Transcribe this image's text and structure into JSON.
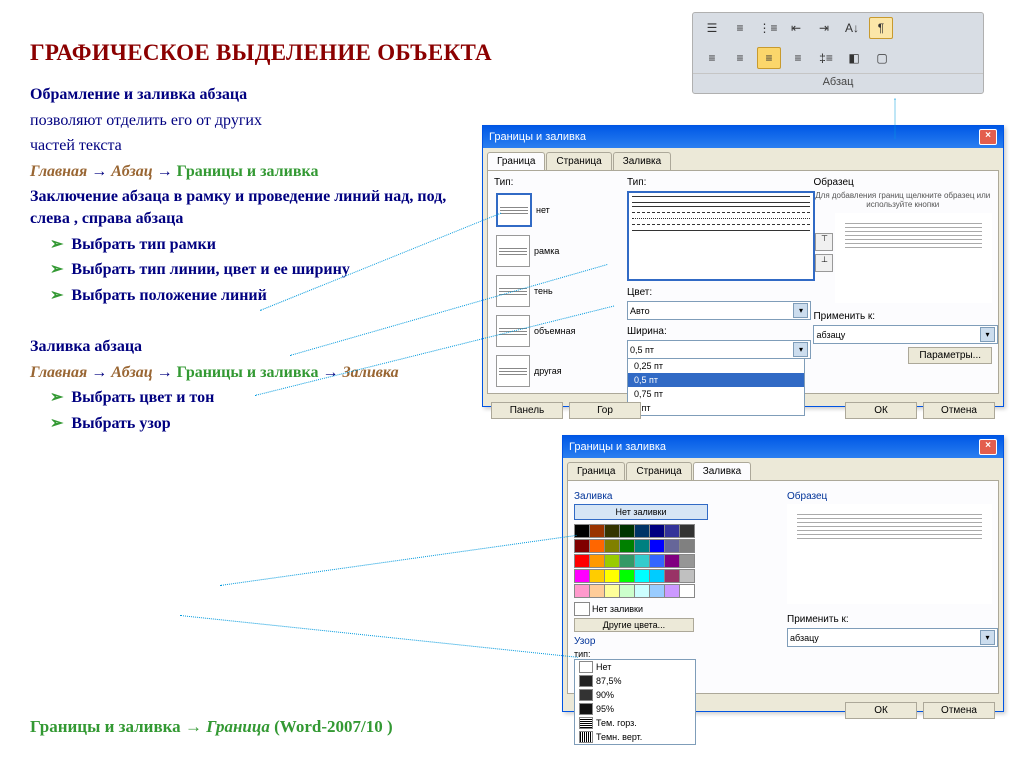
{
  "title": "ГРАФИЧЕСКОЕ ВЫДЕЛЕНИЕ ОБЪЕКТА",
  "intro": {
    "bold_line": "Обрамление и заливка абзаца",
    "line2": "позволяют отделить его от других",
    "line3": "частей текста",
    "path": {
      "p1": "Главная",
      "arrow": " → ",
      "p2": "Абзац",
      "p3": "Границы и заливка"
    },
    "frame_text": "Заключение абзаца в рамку и проведение линий над, под, слева , справа абзаца",
    "bullets1": [
      "Выбрать тип рамки",
      "Выбрать тип линии, цвет и ее ширину",
      "Выбрать положение линий"
    ],
    "fill_title": "Заливка абзаца",
    "path2": {
      "p1": "Главная",
      "arrow": " → ",
      "p2": "Абзац",
      "p3": "Границы и заливка",
      "p4": "Заливка"
    },
    "bullets2": [
      "Выбрать цвет и тон",
      "Выбрать узор"
    ]
  },
  "footer": {
    "t1": "Границы и заливка ",
    "arrow": " → ",
    "t2": "Граница ",
    "t3": "(Word-2007/10 )"
  },
  "ribbon": {
    "label": "Абзац",
    "pilcrow": "¶"
  },
  "dialog1": {
    "title": "Границы и заливка",
    "tabs": [
      "Граница",
      "Страница",
      "Заливка"
    ],
    "labels": {
      "setting": "Тип:",
      "style": "Тип:",
      "color": "Цвет:",
      "width": "Ширина:",
      "preview": "Образец",
      "applyto": "Применить к:"
    },
    "types": [
      "нет",
      "рамка",
      "тень",
      "объемная",
      "другая"
    ],
    "color_auto": "Авто",
    "width_sel": "0,5 пт",
    "width_options": [
      "0,25 пт",
      "0,5 пт",
      "0,75 пт",
      "1 пт"
    ],
    "preview_hint": "Для добавления границ щелкните образец или используйте кнопки",
    "apply_val": "абзацу",
    "btn_params": "Параметры...",
    "btn_panel": "Панель",
    "btn_hline": "Гор",
    "btn_ok": "ОК",
    "btn_cancel": "Отмена"
  },
  "dialog2": {
    "title": "Границы и заливка",
    "tabs": [
      "Граница",
      "Страница",
      "Заливка"
    ],
    "fill_label": "Заливка",
    "no_fill": "Нет заливки",
    "no_fill2": "Нет заливки",
    "more_colors": "Другие цвета...",
    "pattern_label": "Узор",
    "pattern_type": "тип:",
    "patterns": [
      "Нет",
      "87,5%",
      "90%",
      "95%",
      "Тем. горз.",
      "Темн. верт."
    ],
    "preview": "Образец",
    "applyto": "Применить к:",
    "apply_val": "абзацу",
    "btn_ok": "ОК",
    "btn_cancel": "Отмена"
  },
  "colors": [
    "#000000",
    "#993300",
    "#333300",
    "#003300",
    "#003366",
    "#000080",
    "#333399",
    "#333333",
    "#800000",
    "#ff6600",
    "#808000",
    "#008000",
    "#008080",
    "#0000ff",
    "#666699",
    "#808080",
    "#ff0000",
    "#ff9900",
    "#99cc00",
    "#339966",
    "#33cccc",
    "#3366ff",
    "#800080",
    "#969696",
    "#ff00ff",
    "#ffcc00",
    "#ffff00",
    "#00ff00",
    "#00ffff",
    "#00ccff",
    "#993366",
    "#c0c0c0",
    "#ff99cc",
    "#ffcc99",
    "#ffff99",
    "#ccffcc",
    "#ccffff",
    "#99ccff",
    "#cc99ff",
    "#ffffff"
  ]
}
